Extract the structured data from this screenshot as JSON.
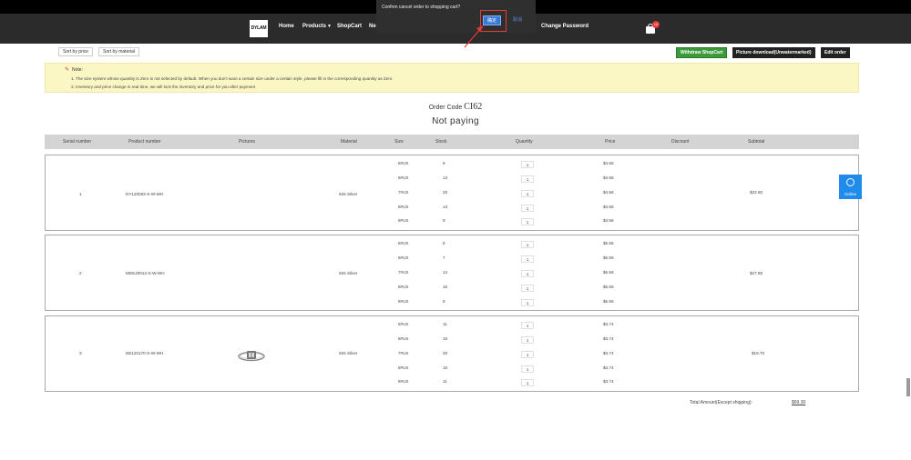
{
  "nav": {
    "logo": "DYLAM",
    "items": [
      "Home",
      "Products",
      "ShopCart",
      "Ne",
      "Change Password"
    ],
    "cart_count": "10"
  },
  "dialog": {
    "message": "Confirm cancel order to shopping cart?",
    "ok": "确定",
    "cancel": "取消"
  },
  "sort": {
    "by_price": "Sort by price",
    "by_material": "Sort by material"
  },
  "actions": {
    "withdraw": "Withdraw ShopCart",
    "download": "Picture download(Unwatermarked)",
    "edit": "Edit order"
  },
  "note": {
    "title": "Note:",
    "line1": "1. The size system whose quantity is Zero is not selected by default. When you don't want a certain size under a certain style, please fill in the corresponding quantity as Zero",
    "line2": "2. Inventory and price change in real time, we will lock the inventory and price for you after payment"
  },
  "order": {
    "code_label": "Order Code",
    "code": "CI62",
    "status": "Not paying"
  },
  "table": {
    "headers": [
      "Serial number",
      "Product number",
      "Pictures",
      "Material",
      "Size",
      "Stock",
      "Quantity",
      "Price",
      "Discount",
      "Subtotal"
    ],
    "groups": [
      {
        "serial": "1",
        "product": "DY120063-S-W-WH",
        "material": "925 Silver",
        "subtotal": "$22.80",
        "rows": [
          {
            "size": "5#US",
            "stock": "9",
            "qty": "1",
            "price": "$4.56"
          },
          {
            "size": "6#US",
            "stock": "13",
            "qty": "1",
            "price": "$4.56"
          },
          {
            "size": "7#US",
            "stock": "20",
            "qty": "1",
            "price": "$4.56"
          },
          {
            "size": "8#US",
            "stock": "13",
            "qty": "1",
            "price": "$4.56"
          },
          {
            "size": "9#US",
            "stock": "9",
            "qty": "1",
            "price": "$4.56"
          }
        ]
      },
      {
        "serial": "2",
        "product": "MM120013-S-W-WH",
        "material": "925 Silver",
        "subtotal": "$27.80",
        "rows": [
          {
            "size": "5#US",
            "stock": "8",
            "qty": "1",
            "price": "$5.56"
          },
          {
            "size": "6#US",
            "stock": "7",
            "qty": "1",
            "price": "$5.56"
          },
          {
            "size": "7#US",
            "stock": "14",
            "qty": "1",
            "price": "$5.56"
          },
          {
            "size": "8#US",
            "stock": "16",
            "qty": "1",
            "price": "$5.56"
          },
          {
            "size": "9#US",
            "stock": "9",
            "qty": "1",
            "price": "$5.56"
          }
        ]
      },
      {
        "serial": "3",
        "product": "NE120170-S-W-WH",
        "material": "925 Silver",
        "subtotal": "$18.70",
        "rows": [
          {
            "size": "5#US",
            "stock": "11",
            "qty": "1",
            "price": "$3.74"
          },
          {
            "size": "6#US",
            "stock": "15",
            "qty": "1",
            "price": "$3.74"
          },
          {
            "size": "7#US",
            "stock": "20",
            "qty": "1",
            "price": "$3.74"
          },
          {
            "size": "8#US",
            "stock": "15",
            "qty": "1",
            "price": "$3.74"
          },
          {
            "size": "9#US",
            "stock": "11",
            "qty": "1",
            "price": "$3.74"
          }
        ]
      }
    ]
  },
  "total": {
    "label": "Total Amount(Except shipping):",
    "value": "$69.30"
  },
  "online": {
    "label": "Online",
    "icon": "headset-icon"
  },
  "colors": {
    "nav_bg": "#2b2b2b",
    "green": "#3c9a3b",
    "note_bg": "#fbf7c5",
    "accent_red": "#e23b3b"
  }
}
